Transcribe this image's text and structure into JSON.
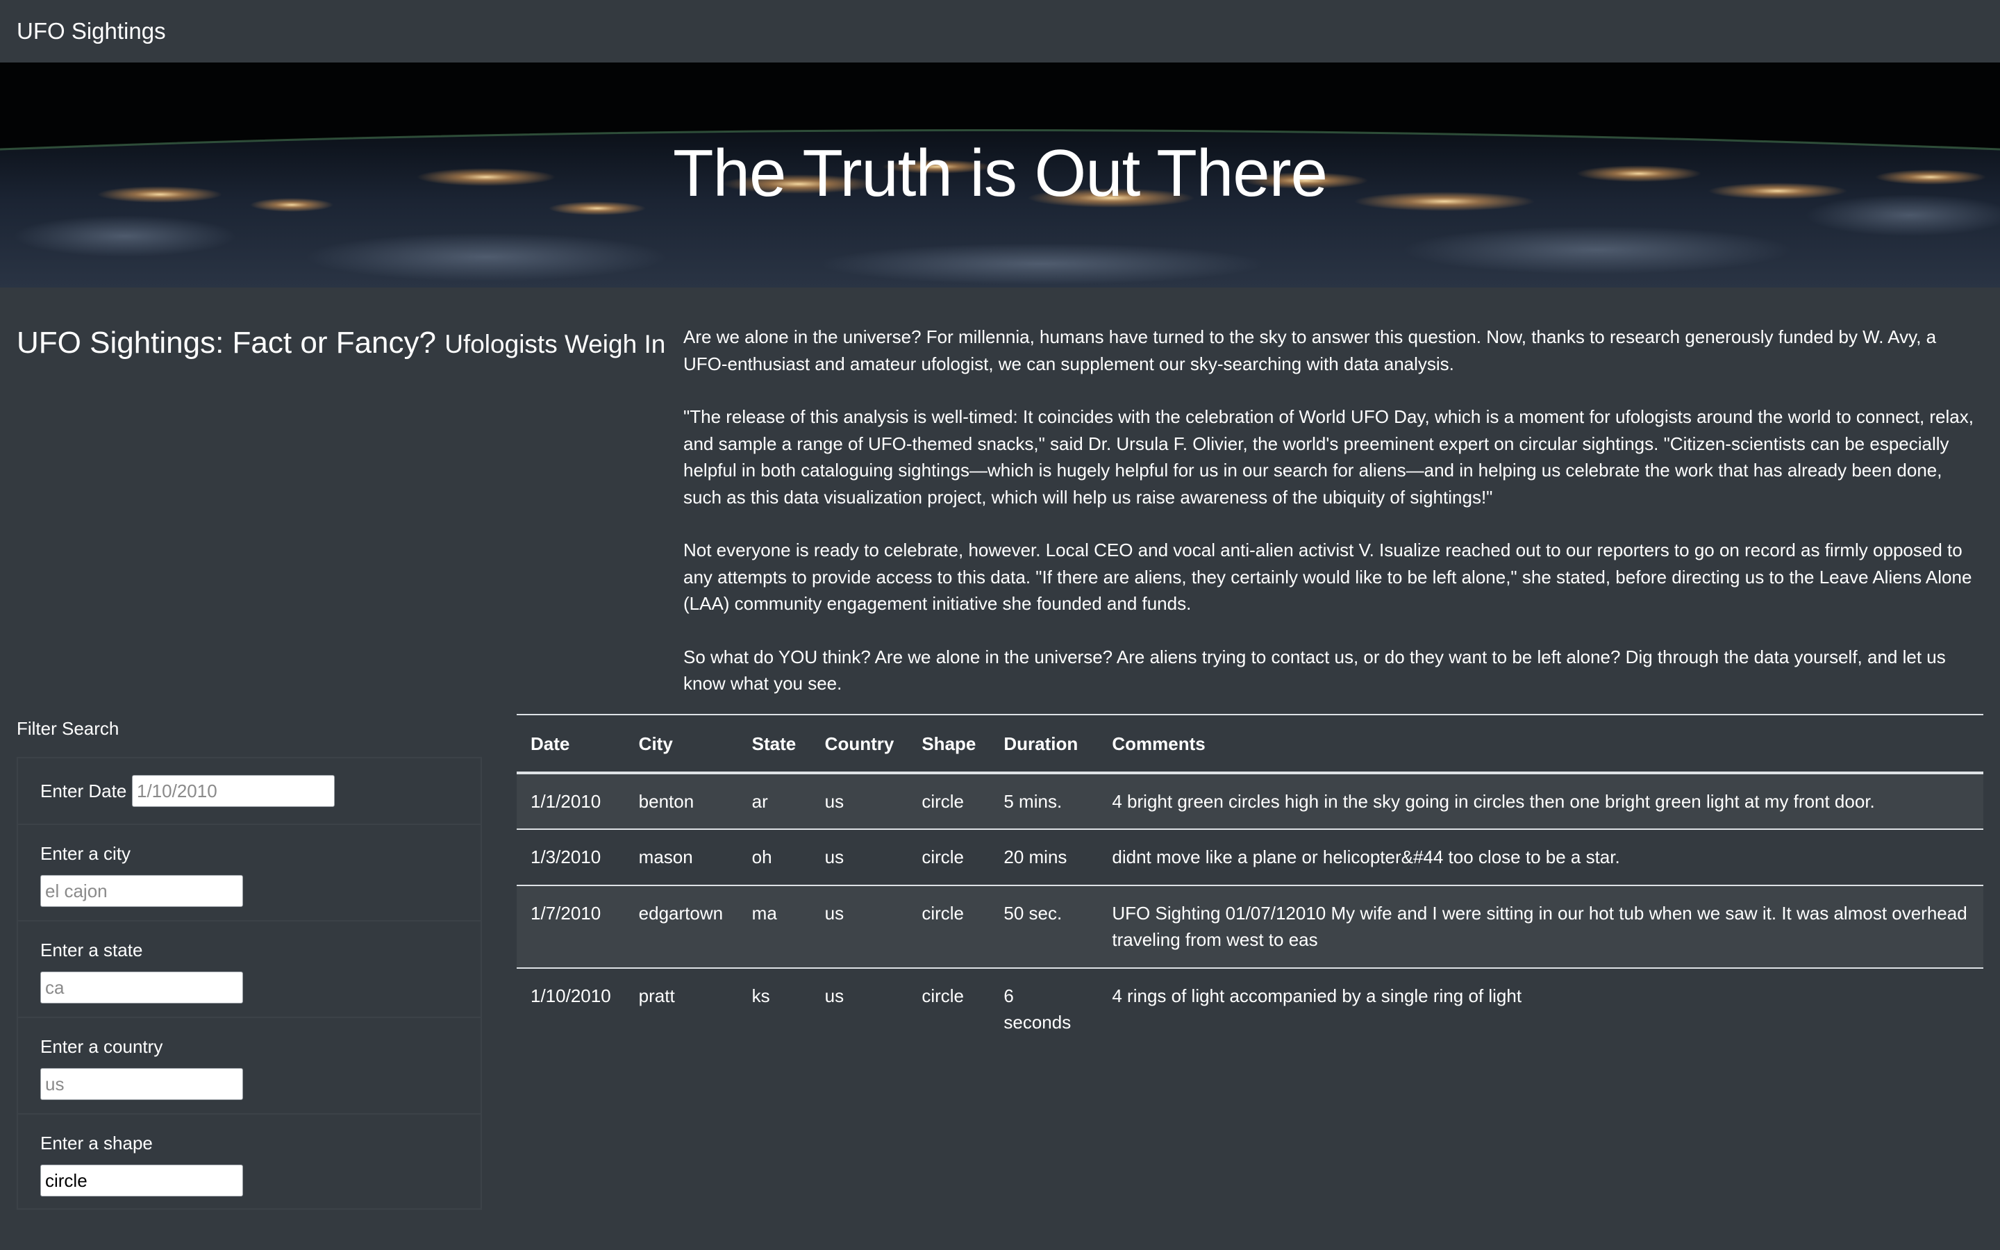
{
  "navbar": {
    "brand": "UFO Sightings"
  },
  "hero": {
    "title": "The Truth is Out There"
  },
  "headline": {
    "title": "UFO Sightings: Fact or Fancy?",
    "subtitle": "Ufologists Weigh In"
  },
  "article": {
    "paragraphs": [
      "Are we alone in the universe? For millennia, humans have turned to the sky to answer this question. Now, thanks to research generously funded by W. Avy, a UFO-enthusiast and amateur ufologist, we can supplement our sky-searching with data analysis.",
      "\"The release of this analysis is well-timed: It coincides with the celebration of World UFO Day, which is a moment for ufologists around the world to connect, relax, and sample a range of UFO-themed snacks,\" said Dr. Ursula F. Olivier, the world's preeminent expert on circular sightings. \"Citizen-scientists can be especially helpful in both cataloguing sightings—which is hugely helpful for us in our search for aliens—and in helping us celebrate the work that has already been done, such as this data visualization project, which will help us raise awareness of the ubiquity of sightings!\"",
      "Not everyone is ready to celebrate, however. Local CEO and vocal anti-alien activist V. Isualize reached out to our reporters to go on record as firmly opposed to any attempts to provide access to this data. \"If there are aliens, they certainly would like to be left alone,\" she stated, before directing us to the Leave Aliens Alone (LAA) community engagement initiative she founded and funds.",
      "So what do YOU think? Are we alone in the universe? Are aliens trying to contact us, or do they want to be left alone? Dig through the data yourself, and let us know what you see."
    ]
  },
  "filters": {
    "title": "Filter Search",
    "date": {
      "label": "Enter Date",
      "placeholder": "1/10/2010",
      "value": ""
    },
    "city": {
      "label": "Enter a city",
      "placeholder": "el cajon",
      "value": ""
    },
    "state": {
      "label": "Enter a state",
      "placeholder": "ca",
      "value": ""
    },
    "country": {
      "label": "Enter a country",
      "placeholder": "us",
      "value": ""
    },
    "shape": {
      "label": "Enter a shape",
      "placeholder": "",
      "value": "circle"
    }
  },
  "table": {
    "headers": [
      "Date",
      "City",
      "State",
      "Country",
      "Shape",
      "Duration",
      "Comments"
    ],
    "rows": [
      [
        "1/1/2010",
        "benton",
        "ar",
        "us",
        "circle",
        "5 mins.",
        "4 bright green circles high in the sky going in circles then one bright green light at my front door."
      ],
      [
        "1/3/2010",
        "mason",
        "oh",
        "us",
        "circle",
        "20 mins",
        "didnt move like a plane or helicopter&#44 too close to be a star."
      ],
      [
        "1/7/2010",
        "edgartown",
        "ma",
        "us",
        "circle",
        "50 sec.",
        "UFO Sighting 01/07/12010 My wife and I were sitting in our hot tub when we saw it. It was almost overhead traveling from west to eas"
      ],
      [
        "1/10/2010",
        "pratt",
        "ks",
        "us",
        "circle",
        "6 seconds",
        "4 rings of light accompanied by a single ring of light"
      ]
    ]
  }
}
